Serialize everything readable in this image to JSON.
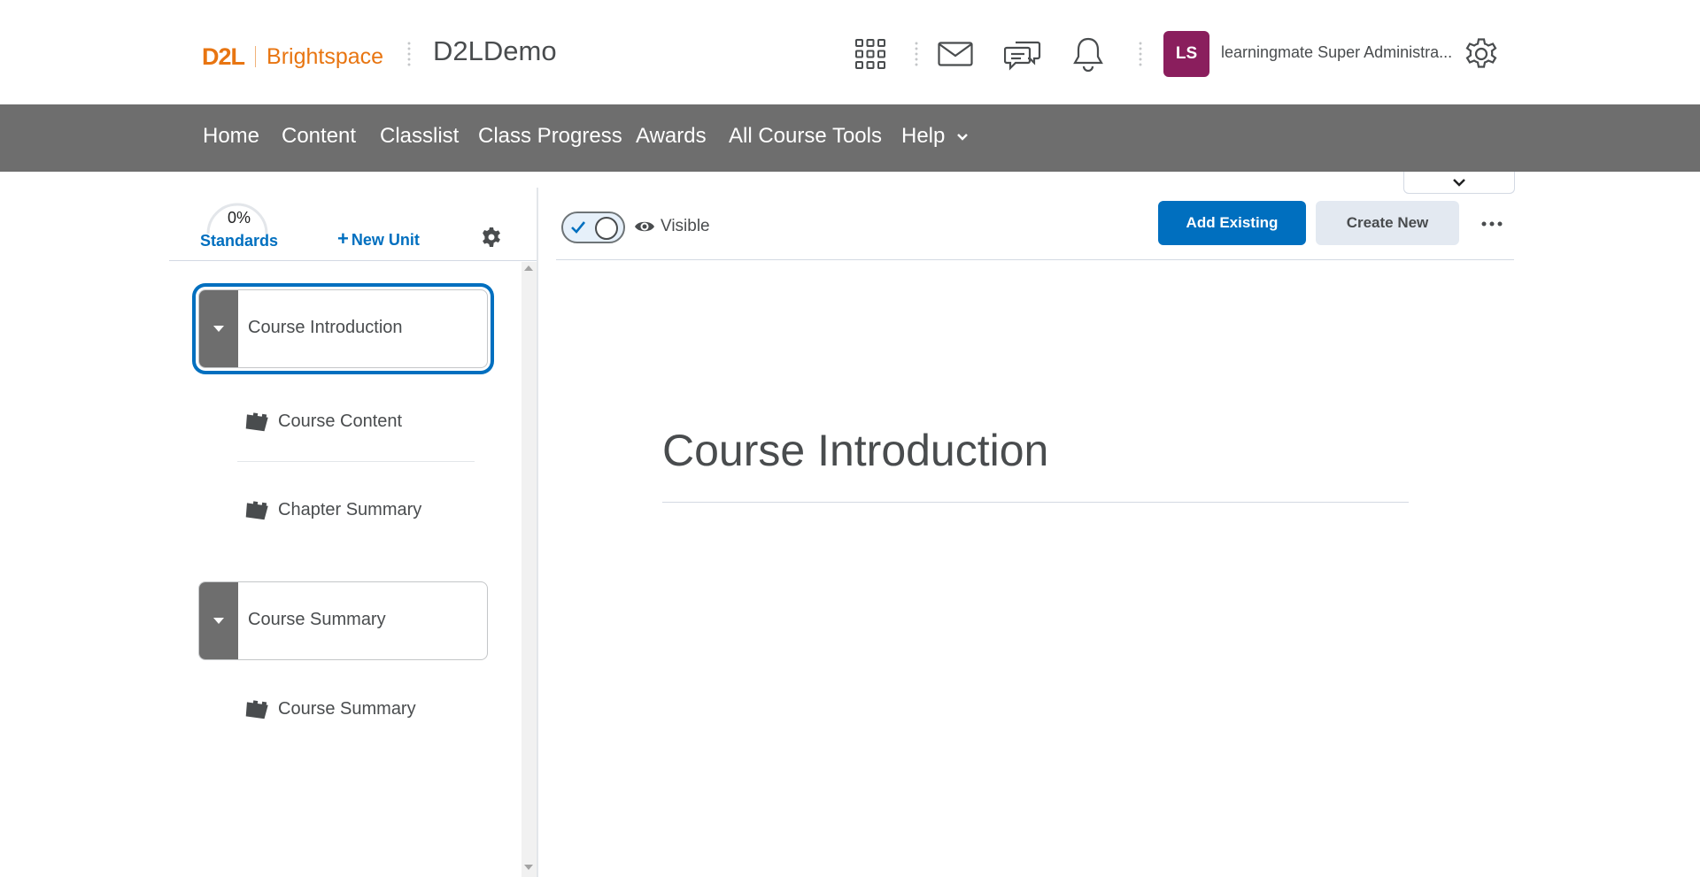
{
  "header": {
    "logo_mark": "D2L",
    "logo_product": "Brightspace",
    "org_name": "D2LDemo",
    "icons": [
      "apps-grid-icon",
      "mail-icon",
      "chat-icon",
      "bell-icon",
      "gear-icon"
    ],
    "user": {
      "initials": "LS",
      "name": "learningmate Super Administra...",
      "avatar_color": "#8a1e5d"
    }
  },
  "nav": {
    "items": [
      "Home",
      "Content",
      "Classlist",
      "Class Progress",
      "Awards",
      "All Course Tools",
      "Help"
    ],
    "background": "#6e6e6e"
  },
  "sidebar": {
    "progress": {
      "percent": "0%",
      "value": 0,
      "label": "Standards"
    },
    "new_unit_label": "New Unit",
    "units": [
      {
        "title": "Course Introduction",
        "focused": true,
        "lessons": [
          "Course Content",
          "Chapter Summary"
        ]
      },
      {
        "title": "Course Summary",
        "focused": false,
        "lessons": [
          "Course Summary"
        ]
      }
    ]
  },
  "main": {
    "visibility": {
      "state": "on",
      "label": "Visible"
    },
    "add_existing_label": "Add Existing",
    "create_new_label": "Create New",
    "title": "Course Introduction"
  },
  "colors": {
    "accent": "#006fbf",
    "brand": "#e87511"
  }
}
